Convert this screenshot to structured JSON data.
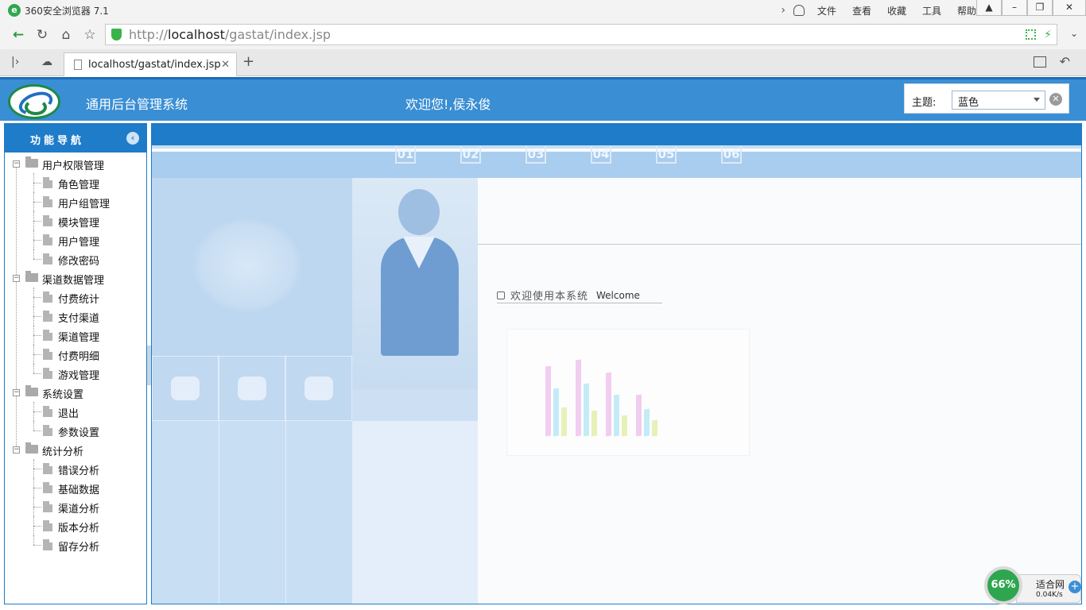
{
  "browser": {
    "app_title": "360安全浏览器 7.1",
    "menus": [
      "文件",
      "查看",
      "收藏",
      "工具",
      "帮助"
    ],
    "url_protocol": "http://",
    "url_host": "localhost",
    "url_path": "/gastat/index.jsp",
    "tab_title": "localhost/gastat/index.jsp"
  },
  "header": {
    "system_name": "通用后台管理系统",
    "welcome": "欢迎您!,侯永俊",
    "theme_label": "主题:",
    "theme_value": "蓝色"
  },
  "nav": {
    "title": "功能导航",
    "groups": [
      {
        "label": "用户权限管理",
        "items": [
          "角色管理",
          "用户组管理",
          "模块管理",
          "用户管理",
          "修改密码"
        ]
      },
      {
        "label": "渠道数据管理",
        "items": [
          "付费统计",
          "支付渠道",
          "渠道管理",
          "付费明细",
          "游戏管理"
        ]
      },
      {
        "label": "系统设置",
        "items": [
          "退出",
          "参数设置"
        ]
      },
      {
        "label": "统计分析",
        "items": [
          "错误分析",
          "基础数据",
          "渠道分析",
          "版本分析",
          "留存分析"
        ]
      }
    ]
  },
  "main": {
    "banner_numbers": [
      "01",
      "02",
      "03",
      "04",
      "05",
      "06"
    ],
    "welcome_cn": "欢迎使用本系统",
    "welcome_en": "Welcome"
  },
  "speed_widget": {
    "percent": "66%",
    "label": "适合网",
    "rate": "0.04K/s"
  }
}
